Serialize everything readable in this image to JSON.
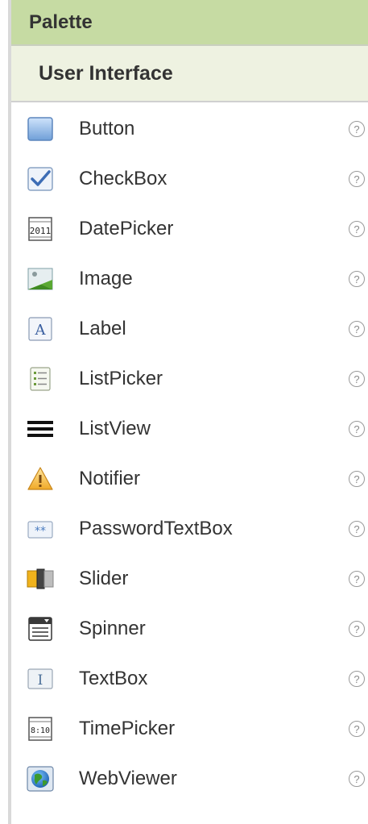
{
  "palette": {
    "title": "Palette",
    "category": "User Interface",
    "help_glyph": "?",
    "items": [
      {
        "label": "Button",
        "icon": "button-icon"
      },
      {
        "label": "CheckBox",
        "icon": "checkbox-icon"
      },
      {
        "label": "DatePicker",
        "icon": "datepicker-icon",
        "icon_text": "2011"
      },
      {
        "label": "Image",
        "icon": "image-icon"
      },
      {
        "label": "Label",
        "icon": "label-icon",
        "icon_text": "A"
      },
      {
        "label": "ListPicker",
        "icon": "listpicker-icon"
      },
      {
        "label": "ListView",
        "icon": "listview-icon"
      },
      {
        "label": "Notifier",
        "icon": "notifier-icon"
      },
      {
        "label": "PasswordTextBox",
        "icon": "password-textbox-icon",
        "icon_text": "**"
      },
      {
        "label": "Slider",
        "icon": "slider-icon"
      },
      {
        "label": "Spinner",
        "icon": "spinner-icon"
      },
      {
        "label": "TextBox",
        "icon": "textbox-icon",
        "icon_text": "I"
      },
      {
        "label": "TimePicker",
        "icon": "timepicker-icon",
        "icon_text": "8:10"
      },
      {
        "label": "WebViewer",
        "icon": "webviewer-icon"
      }
    ]
  }
}
